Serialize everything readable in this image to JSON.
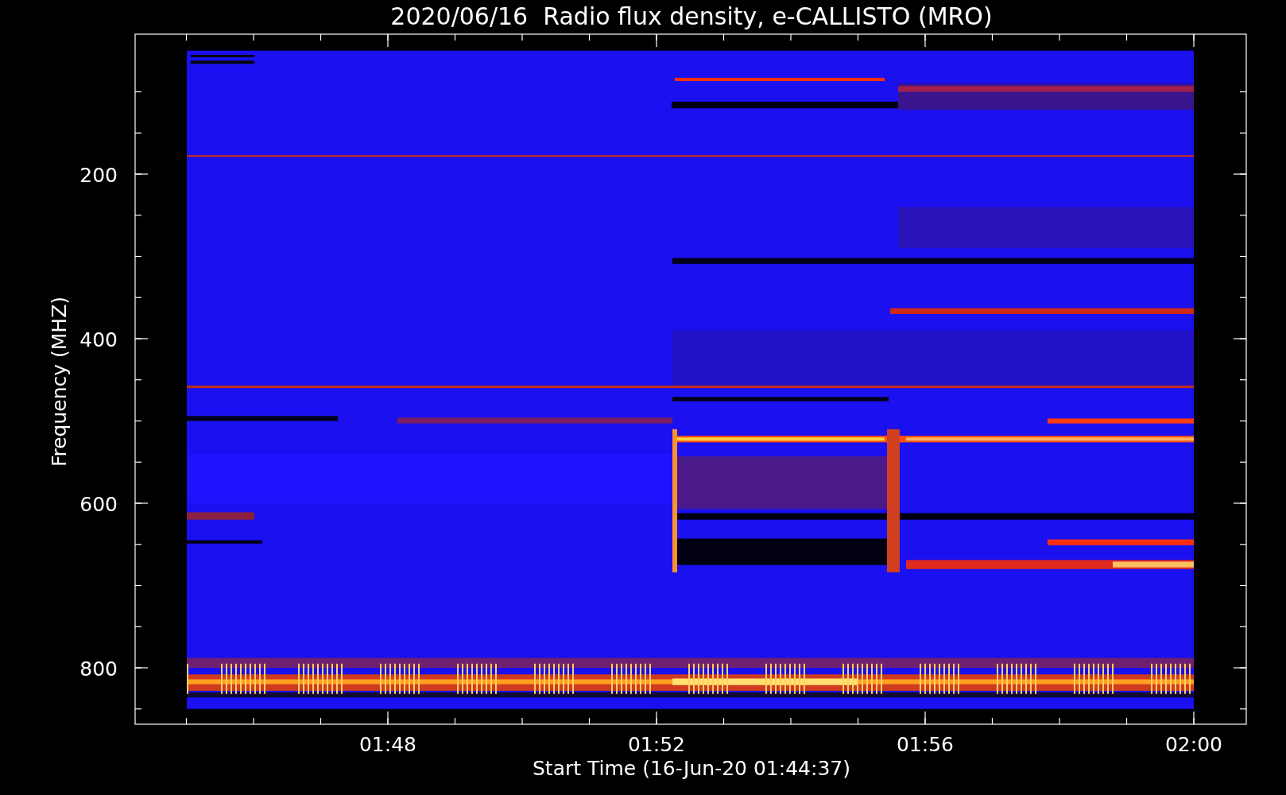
{
  "title": "2020/06/16  Radio flux density, e-CALLISTO (MRO)",
  "y_axis": {
    "label": "Frequency (MHZ)",
    "ticks": [
      "200",
      "400",
      "600",
      "800"
    ]
  },
  "x_axis": {
    "label": "Start Time (16-Jun-20 01:44:37)",
    "ticks": [
      "01:48",
      "01:52",
      "01:56",
      "02:00"
    ]
  }
}
